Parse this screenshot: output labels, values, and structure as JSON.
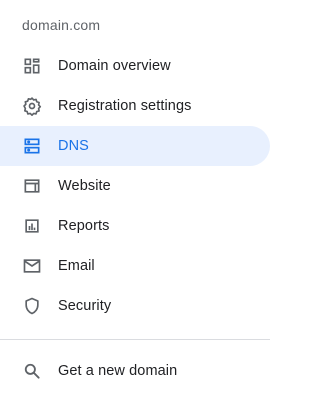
{
  "domain": "domain.com",
  "nav": {
    "items": [
      {
        "label": "Domain overview",
        "icon": "dashboard-icon"
      },
      {
        "label": "Registration settings",
        "icon": "gear-icon"
      },
      {
        "label": "DNS",
        "icon": "dns-icon",
        "active": true
      },
      {
        "label": "Website",
        "icon": "web-icon"
      },
      {
        "label": "Reports",
        "icon": "chart-icon"
      },
      {
        "label": "Email",
        "icon": "mail-icon"
      },
      {
        "label": "Security",
        "icon": "shield-icon"
      }
    ],
    "get_domain": {
      "label": "Get a new domain",
      "icon": "search-icon"
    }
  },
  "colors": {
    "active_bg": "#e8f0fe",
    "active_text": "#1a73e8",
    "text": "#202124",
    "icon": "#5f6368",
    "muted": "#5f6368",
    "divider": "#dadce0"
  }
}
